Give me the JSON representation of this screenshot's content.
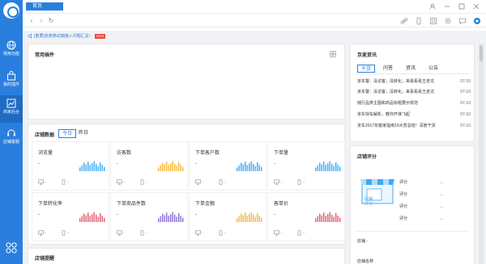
{
  "sidebar": {
    "items": [
      {
        "label": "常用功能",
        "icon": "globe-icon"
      },
      {
        "label": "我的插件",
        "icon": "bag-icon"
      },
      {
        "label": "商家后台",
        "icon": "chart-icon"
      },
      {
        "label": "店铺客服",
        "icon": "headset-icon"
      }
    ],
    "active_index": 2
  },
  "browser": {
    "tab_title": "首页",
    "back": "‹",
    "forward": "›",
    "reload": "↻"
  },
  "notice": {
    "text": "[重要]京麦移动端接入问题汇总！",
    "badge": "NEW"
  },
  "plugins": {
    "title": "常用插件"
  },
  "shop_data": {
    "title": "店铺数据",
    "tabs": [
      "今日",
      "昨日"
    ],
    "active_tab": 0,
    "metrics": [
      {
        "label": "浏览量",
        "value": "-",
        "pc": "-",
        "mobile": "-",
        "color": "#3fa9f5"
      },
      {
        "label": "访客数",
        "value": "-",
        "pc": "-",
        "mobile": "-",
        "color": "#f5b63a"
      },
      {
        "label": "下单客户数",
        "value": "-",
        "pc": "-",
        "mobile": "-",
        "color": "#3fa9f5"
      },
      {
        "label": "下单量",
        "value": "-",
        "pc": "-",
        "mobile": "-",
        "color": "#3fa9f5"
      },
      {
        "label": "下单转化率",
        "value": "-",
        "pc": "-",
        "mobile": "-",
        "color": "#e55a6b"
      },
      {
        "label": "下单商品件数",
        "value": "-",
        "pc": "-",
        "mobile": "-",
        "color": "#8b6cd9"
      },
      {
        "label": "下单金额",
        "value": "-",
        "pc": "-",
        "mobile": "-",
        "color": "#f5b63a"
      },
      {
        "label": "客单价",
        "value": "-",
        "pc": "-",
        "mobile": "-",
        "color": "#e55a6b"
      }
    ]
  },
  "remind": {
    "title": "店铺提醒"
  },
  "news": {
    "title": "京麦资讯",
    "tabs": [
      "干货",
      "问答",
      "资讯",
      "公告"
    ],
    "active_tab": 0,
    "items": [
      {
        "title": "京东警：没访客，没转化，来看看看王走坑",
        "date": "07-10"
      },
      {
        "title": "京东警：没访客，没转化，来看看看王走坑",
        "date": "07-10"
      },
      {
        "title": "储行品类主图和商品标题要示规范",
        "date": "07-10"
      },
      {
        "title": "京东快车解析，教你开准飞起",
        "date": "07-10"
      },
      {
        "title": "京东2017年搬家指南19大冒总结！深度干货",
        "date": "07-10"
      }
    ]
  },
  "score": {
    "title": "店铺评分",
    "shop_label": "店铺评分",
    "rows": [
      {
        "label": "评分",
        "value": "..."
      },
      {
        "label": "评分",
        "value": "..."
      },
      {
        "label": "评分",
        "value": "..."
      },
      {
        "label": "评分",
        "value": "..."
      }
    ],
    "info": [
      {
        "label": "店铺",
        "value": "-"
      },
      {
        "label": "店铺名称",
        "value": ""
      }
    ]
  }
}
